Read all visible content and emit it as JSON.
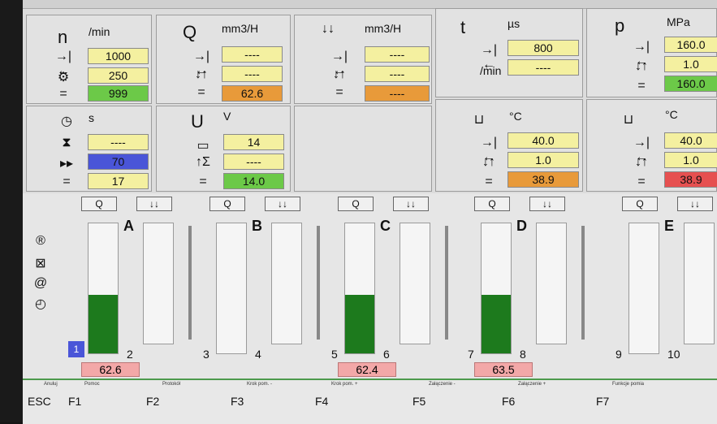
{
  "panels": {
    "n": {
      "symbol": "n",
      "unit": "/min",
      "set": "1000",
      "limit": "250",
      "actual": "999"
    },
    "q": {
      "symbol": "Q",
      "unit": "mm3/H",
      "set": "----",
      "limit": "----",
      "actual": "62.6"
    },
    "q2": {
      "unit": "mm3/H",
      "set": "----",
      "limit": "----",
      "actual": "----"
    },
    "t": {
      "symbol": "t",
      "unit": "µs",
      "set": "800",
      "limit": "----",
      "per_min": "/min"
    },
    "p": {
      "symbol": "p",
      "unit": "MPa",
      "set": "160.0",
      "limit": "1.0",
      "actual": "160.0"
    },
    "time": {
      "unit": "s",
      "v1": "----",
      "v2": "70",
      "v3": "17"
    },
    "u": {
      "symbol": "U",
      "unit": "V",
      "v1": "14",
      "v2": "----",
      "v3": "14.0"
    },
    "temp1": {
      "unit": "°C",
      "set": "40.0",
      "limit": "1.0",
      "actual": "38.9"
    },
    "temp2": {
      "unit": "°C",
      "set": "40.0",
      "limit": "1.0",
      "actual": "38.9"
    }
  },
  "bars": {
    "headers": {
      "q": "Q",
      "inj": "↓↓"
    },
    "columns": [
      {
        "letter": "A",
        "fill": 0.45,
        "index_left": "1",
        "index_right": "2",
        "value": "62.6"
      },
      {
        "letter": "B",
        "fill": 0,
        "index_left": "3",
        "index_right": "4",
        "value": ""
      },
      {
        "letter": "C",
        "fill": 0.45,
        "index_left": "5",
        "index_right": "6",
        "value": "62.4"
      },
      {
        "letter": "D",
        "fill": 0.45,
        "index_left": "7",
        "index_right": "8",
        "value": "63.5"
      },
      {
        "letter": "E",
        "fill": 0,
        "index_left": "9",
        "index_right": "10",
        "value": ""
      }
    ]
  },
  "fkeys": [
    {
      "key": "ESC",
      "caption": "Anuluj"
    },
    {
      "key": "F1",
      "caption": "Pomoc"
    },
    {
      "key": "F2",
      "caption": "Protokół"
    },
    {
      "key": "F3",
      "caption": "Krok pom. -"
    },
    {
      "key": "F4",
      "caption": "Krok pom. +"
    },
    {
      "key": "F5",
      "caption": "Załączenie -"
    },
    {
      "key": "F6",
      "caption": "Załączenie +"
    },
    {
      "key": "F7",
      "caption": "Funkcje pomia"
    }
  ],
  "colors": {
    "green": "#6cc948",
    "yellow": "#f4f0a0",
    "orange": "#e89a3a",
    "blue": "#4a55d8",
    "red": "#e65050"
  }
}
